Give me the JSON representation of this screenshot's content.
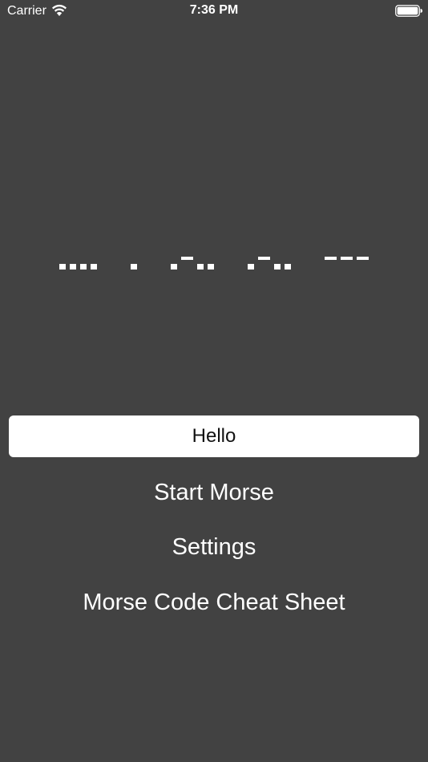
{
  "status_bar": {
    "carrier": "Carrier",
    "time": "7:36 PM",
    "wifi_icon": "wifi-icon",
    "battery_icon": "battery-full-icon"
  },
  "morse_display": {
    "letters": [
      {
        "letter": "H",
        "code": "...."
      },
      {
        "letter": "E",
        "code": "."
      },
      {
        "letter": "L",
        "code": ".-.."
      },
      {
        "letter": "L",
        "code": ".-.."
      },
      {
        "letter": "O",
        "code": "---"
      }
    ]
  },
  "input": {
    "value": "Hello"
  },
  "buttons": {
    "start": "Start Morse",
    "settings": "Settings",
    "cheat_sheet": "Morse Code Cheat Sheet"
  },
  "colors": {
    "background": "#424242",
    "text": "#ffffff",
    "input_background": "#ffffff"
  }
}
